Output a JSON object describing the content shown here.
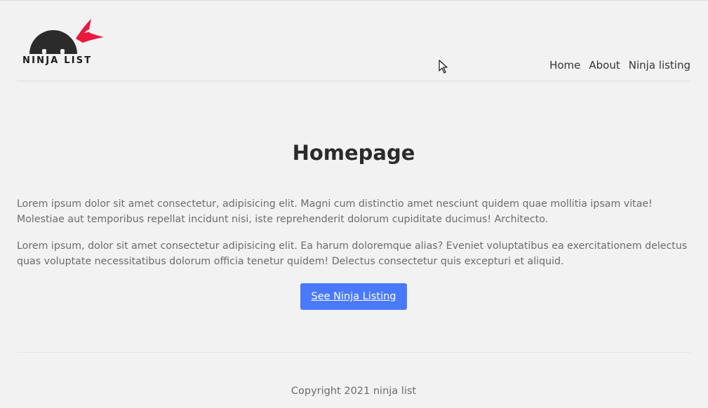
{
  "brand": {
    "logo_text": "NINJA LIST",
    "colors": {
      "head": "#2b2b2b",
      "headband": "#e8193c"
    }
  },
  "nav": {
    "items": [
      {
        "label": "Home"
      },
      {
        "label": "About"
      },
      {
        "label": "Ninja listing"
      }
    ]
  },
  "main": {
    "title": "Homepage",
    "paragraph_1": "Lorem ipsum dolor sit amet consectetur, adipisicing elit. Magni cum distinctio amet nesciunt quidem quae mollitia ipsam vitae! Molestiae aut temporibus repellat incidunt nisi, iste reprehenderit dolorum cupiditate ducimus! Architecto.",
    "paragraph_2": "Lorem ipsum, dolor sit amet consectetur adipisicing elit. Ea harum doloremque alias? Eveniet voluptatibus ea exercitationem delectus quas voluptate necessitatibus dolorum officia tenetur quidem! Delectus consectetur quis excepturi et aliquid.",
    "cta_label": "See Ninja Listing",
    "cta_color": "#4979ff"
  },
  "footer": {
    "copyright": "Copyright 2021 ninja list"
  }
}
